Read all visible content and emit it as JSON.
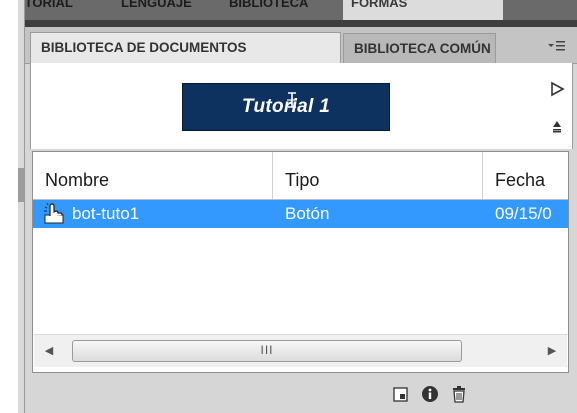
{
  "top_tabs": [
    "HISTORIAL",
    "LENGUAJE",
    "BIBLIOTECA",
    "FORMAS"
  ],
  "tabs": {
    "active": "BIBLIOTECA DE DOCUMENTOS",
    "inactive": "BIBLIOTECA COMÚN"
  },
  "panel_menu_icon": "panel-options-menu-icon",
  "preview": {
    "button_text": "Tutorial 1",
    "play_icon": "play-icon",
    "stop_icon": "stop-icon"
  },
  "list": {
    "columns": [
      "Nombre",
      "Tipo",
      "Fecha"
    ],
    "rows": [
      {
        "name": "bot-tuto1",
        "type": "Botón",
        "date": "09/15/0",
        "icon": "button-symbol-icon",
        "selected": true
      }
    ],
    "scroll_thumb_grip": "III"
  },
  "bottom_icons": [
    "new-symbol-icon",
    "properties-icon",
    "delete-icon"
  ],
  "colors": {
    "selection": "#3399ff",
    "preview_button_bg": "#0d3260",
    "panel_bg": "#d6d6d6"
  }
}
